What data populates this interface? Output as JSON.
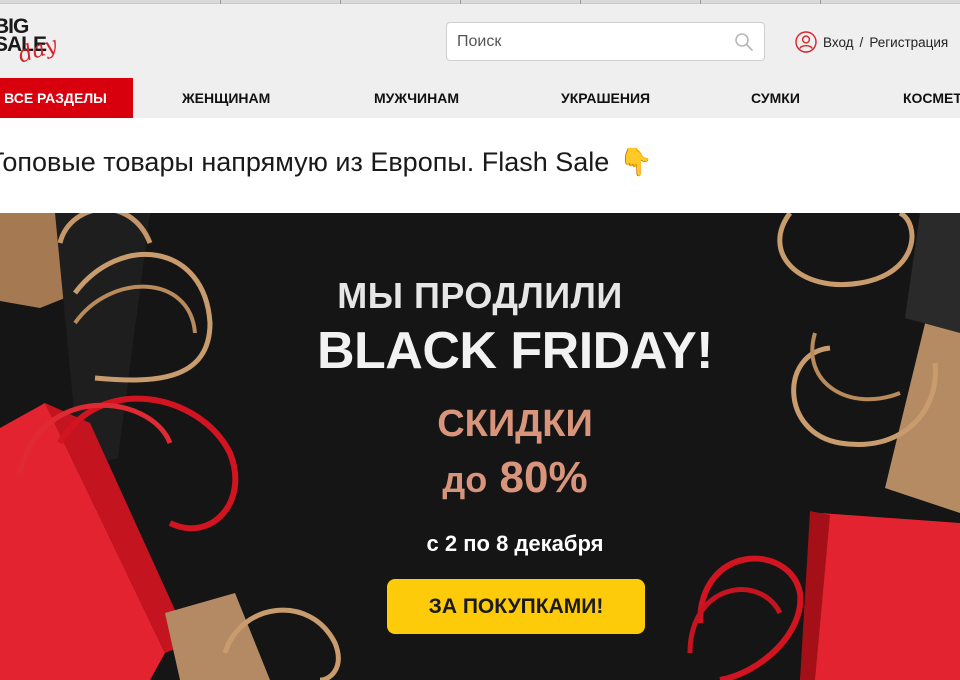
{
  "logo": {
    "line1": "BIG",
    "line2": "SALE",
    "script": "day"
  },
  "search": {
    "placeholder": "Поиск"
  },
  "account": {
    "login": "Вход",
    "separator": "/",
    "register": "Регистрация"
  },
  "nav": {
    "items": [
      {
        "label": "ВСЕ РАЗДЕЛЫ"
      },
      {
        "label": "ЖЕНЩИНАМ"
      },
      {
        "label": "МУЖЧИНАМ"
      },
      {
        "label": "УКРАШЕНИЯ"
      },
      {
        "label": "СУМКИ"
      },
      {
        "label": "КОСМЕТИКА"
      }
    ],
    "active_color": "#d8000c"
  },
  "tagline": {
    "text": "Топовые товары напрямую из Европы. Flash Sale",
    "emoji": "👇"
  },
  "banner": {
    "line1": "МЫ ПРОДЛИЛИ",
    "line2": "BLACK FRIDAY!",
    "line3": "СКИДКИ",
    "line4_prefix": "до",
    "line4_value": "80%",
    "dates": "с 2 по 8 декабря",
    "cta": "ЗА ПОКУПКАМИ!",
    "background_color": "#151515",
    "accent_color": "#d9957c",
    "cta_color": "#fecb0a"
  }
}
